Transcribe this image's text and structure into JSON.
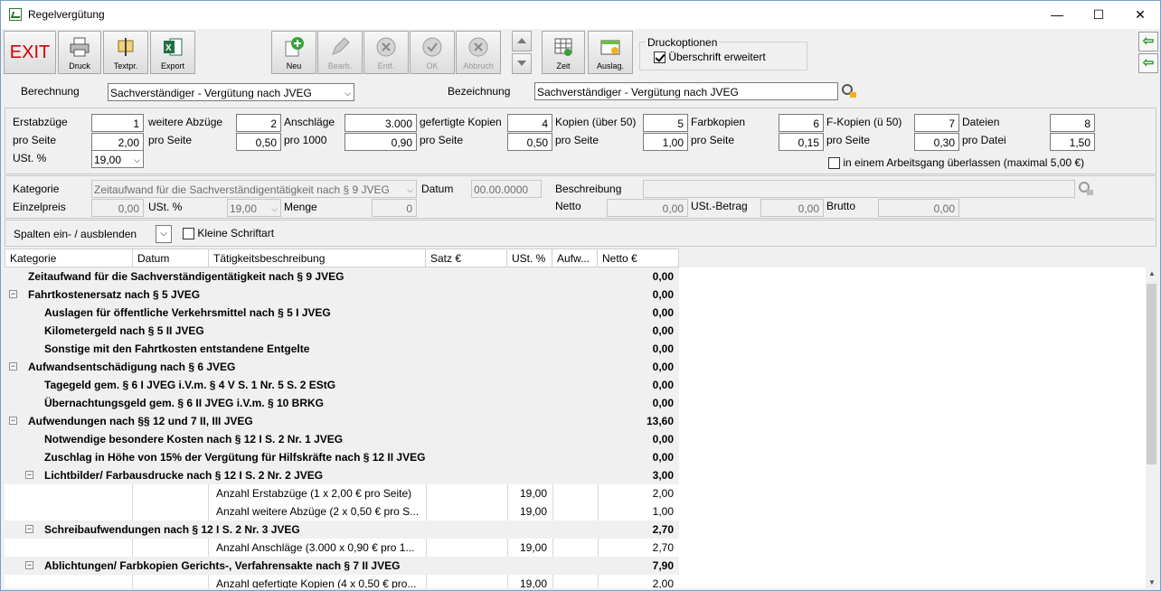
{
  "window": {
    "title": "Regelvergütung",
    "minimize": "—",
    "maximize": "☐",
    "close": "✕"
  },
  "toolbar": {
    "exit": "EXIT",
    "druck": "Druck",
    "textpr": "Textpr.",
    "export": "Export",
    "neu": "Neu",
    "bearb": "Bearb.",
    "entf": "Entf.",
    "ok": "OK",
    "abbruch": "Abbruch",
    "zeit": "Zeit",
    "auslag": "Auslag.",
    "druckoptionen": "Druckoptionen",
    "ueberschrift": "Überschrift erweitert"
  },
  "form": {
    "berechnung_label": "Berechnung",
    "berechnung_value": "Sachverständiger - Vergütung nach JVEG",
    "bezeichnung_label": "Bezeichnung",
    "bezeichnung_value": "Sachverständiger - Vergütung nach JVEG"
  },
  "params": {
    "erstabzuege": "Erstabzüge",
    "erstabzuege_v": "1",
    "pro_seite": "pro Seite",
    "erst_pro_seite_v": "2,00",
    "ust": "USt. %",
    "ust_v": "19,00",
    "weitere": "weitere Abzüge",
    "weitere_v": "2",
    "weitere_pro_seite_v": "0,50",
    "anschlaege": "Anschläge",
    "anschlaege_v": "3.000",
    "pro1000": "pro 1000",
    "pro1000_v": "0,90",
    "kopien": "gefertigte Kopien",
    "kopien_v": "4",
    "kopien_pro_seite_v": "0,50",
    "kopien50": "Kopien (über 50)",
    "kopien50_v": "5",
    "kopien50_pro_seite_v": "1,00",
    "farb": "Farbkopien",
    "farb_v": "6",
    "farb_pro_seite_v": "0,15",
    "fkop": "F-Kopien (ü 50)",
    "fkop_v": "7",
    "fkop_pro_seite_v": "0,30",
    "dateien": "Dateien",
    "dateien_v": "8",
    "pro_datei": "pro Datei",
    "pro_datei_v": "1,50",
    "arbeitsgang": "in einem Arbeitsgang überlassen (maximal 5,00 €)"
  },
  "detail": {
    "kategorie": "Kategorie",
    "kategorie_v": "Zeitaufwand für die Sachverständigentätigkeit nach § 9 JVEG",
    "datum": "Datum",
    "datum_v": "00.00.0000",
    "beschreibung": "Beschreibung",
    "einzelpreis": "Einzelpreis",
    "einzelpreis_v": "0,00",
    "ust": "USt. %",
    "ust_v": "19,00",
    "menge": "Menge",
    "menge_v": "0",
    "netto": "Netto",
    "netto_v": "0,00",
    "ustbetrag": "USt.-Betrag",
    "ustbetrag_v": "0,00",
    "brutto": "Brutto",
    "brutto_v": "0,00"
  },
  "columns_bar": {
    "label": "Spalten ein- / ausblenden",
    "kleine": "Kleine Schriftart"
  },
  "table": {
    "headers": [
      "Kategorie",
      "Datum",
      "Tätigkeitsbeschreibung",
      "Satz €",
      "USt. %",
      "Aufw...",
      "Netto €"
    ],
    "rows": [
      {
        "level": 0,
        "text": "Zeitaufwand für die Sachverständigentätigkeit nach § 9 JVEG",
        "netto": "0,00",
        "bold": true
      },
      {
        "level": 0,
        "text": "Fahrtkostenersatz nach § 5 JVEG",
        "netto": "0,00",
        "bold": true,
        "toggle": "−"
      },
      {
        "level": 1,
        "text": "Auslagen für öffentliche Verkehrsmittel nach § 5 I JVEG",
        "netto": "0,00",
        "bold": true
      },
      {
        "level": 1,
        "text": "Kilometergeld nach § 5 II JVEG",
        "netto": "0,00",
        "bold": true
      },
      {
        "level": 1,
        "text": "Sonstige mit den Fahrtkosten entstandene Entgelte",
        "netto": "0,00",
        "bold": true
      },
      {
        "level": 0,
        "text": "Aufwandsentschädigung nach § 6 JVEG",
        "netto": "0,00",
        "bold": true,
        "toggle": "−"
      },
      {
        "level": 1,
        "text": "Tagegeld gem. § 6 I JVEG i.V.m. § 4 V S. 1 Nr. 5 S. 2 EStG",
        "netto": "0,00",
        "bold": true
      },
      {
        "level": 1,
        "text": "Übernachtungsgeld gem. § 6 II JVEG i.V.m. § 10 BRKG",
        "netto": "0,00",
        "bold": true
      },
      {
        "level": 0,
        "text": "Aufwendungen nach §§ 12 und 7 II, III JVEG",
        "netto": "13,60",
        "bold": true,
        "toggle": "−"
      },
      {
        "level": 1,
        "text": "Notwendige besondere Kosten nach § 12 I S. 2 Nr. 1 JVEG",
        "netto": "0,00",
        "bold": true
      },
      {
        "level": 1,
        "text": "Zuschlag in Höhe von 15% der Vergütung für Hilfskräfte nach § 12 II JVEG",
        "netto": "0,00",
        "bold": true
      },
      {
        "level": 1,
        "text": "Lichtbilder/ Farbausdrucke nach § 12 I S. 2 Nr. 2 JVEG",
        "netto": "3,00",
        "bold": true,
        "toggle": "−"
      },
      {
        "level": 2,
        "desc": "Anzahl Erstabzüge (1 x 2,00 € pro Seite)",
        "ust": "19,00",
        "netto": "2,00"
      },
      {
        "level": 2,
        "desc": "Anzahl weitere Abzüge (2 x 0,50 € pro S...",
        "ust": "19,00",
        "netto": "1,00"
      },
      {
        "level": 1,
        "text": "Schreibaufwendungen nach § 12 I S. 2 Nr. 3 JVEG",
        "netto": "2,70",
        "bold": true,
        "toggle": "−"
      },
      {
        "level": 2,
        "desc": "Anzahl Anschläge (3.000 x 0,90 € pro 1...",
        "ust": "19,00",
        "netto": "2,70"
      },
      {
        "level": 1,
        "text": "Ablichtungen/ Farbkopien Gerichts-, Verfahrensakte nach § 7 II JVEG",
        "netto": "7,90",
        "bold": true,
        "toggle": "−"
      },
      {
        "level": 2,
        "desc": "Anzahl gefertigte Kopien (4 x 0,50 € pro...",
        "ust": "19,00",
        "netto": "2,00"
      }
    ]
  },
  "icons": {
    "printer": "printer-icon",
    "textpr": "text-icon",
    "excel": "excel-icon",
    "add": "plus-icon",
    "edit": "pencil-icon",
    "delete": "x-icon",
    "ok": "check-icon",
    "cancel": "x-icon",
    "time": "grid-icon",
    "expense": "folder-icon"
  }
}
